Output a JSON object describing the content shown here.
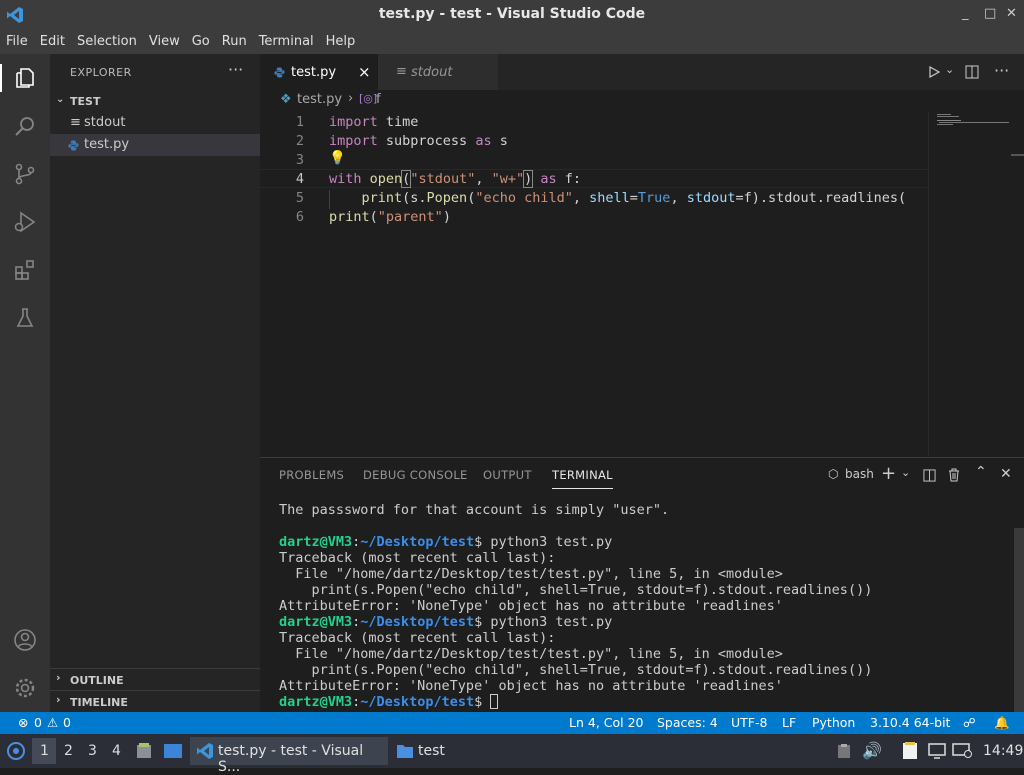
{
  "window": {
    "title": "test.py - test - Visual Studio Code",
    "minimize": "_",
    "maximize": "□",
    "close": "✕"
  },
  "menu": [
    "File",
    "Edit",
    "Selection",
    "View",
    "Go",
    "Run",
    "Terminal",
    "Help"
  ],
  "activity_icons": [
    "explorer-icon",
    "search-icon",
    "source-control-icon",
    "run-debug-icon",
    "extensions-icon",
    "testing-icon",
    "account-icon",
    "settings-gear-icon"
  ],
  "sidebar": {
    "title": "EXPLORER",
    "more": "···",
    "folder": "TEST",
    "files": [
      {
        "name": "stdout",
        "icon": "≡"
      },
      {
        "name": "test.py",
        "icon": "python-icon"
      }
    ],
    "outline": "OUTLINE",
    "timeline": "TIMELINE"
  },
  "tabs": [
    {
      "label": "test.py",
      "close": "×"
    },
    {
      "label": "stdout"
    }
  ],
  "breadcrumb": {
    "file": "test.py",
    "sep": "›",
    "symbol": "f"
  },
  "editor": {
    "line_numbers": [
      "1",
      "2",
      "3",
      "4",
      "5",
      "6"
    ],
    "current_line": 4
  },
  "panel": {
    "tabs": [
      "PROBLEMS",
      "DEBUG CONSOLE",
      "OUTPUT",
      "TERMINAL"
    ],
    "active_tab": "TERMINAL",
    "shell": "bash",
    "terminal": {
      "line1": "The passsword for that account is simply \"user\".",
      "user": "dartz@VM3",
      "path": "~/Desktop/test",
      "cmd": "$ python3 test.py",
      "tb1": "Traceback (most recent call last):",
      "tb2": "  File \"/home/dartz/Desktop/test/test.py\", line 5, in <module>",
      "tb3": "    print(s.Popen(\"echo child\", shell=True, stdout=f).stdout.readlines())",
      "tb4": "AttributeError: 'NoneType' object has no attribute 'readlines'",
      "prompt_end": "$ "
    }
  },
  "statusbar": {
    "errors": "0",
    "warnings": "0",
    "position": "Ln 4, Col 20",
    "spaces": "Spaces: 4",
    "encoding": "UTF-8",
    "eol": "LF",
    "language": "Python",
    "interpreter": "3.10.4 64-bit"
  },
  "taskbar": {
    "workspaces": [
      "1",
      "2",
      "3",
      "4"
    ],
    "apps": [
      {
        "label": "test.py - test - Visual S..."
      },
      {
        "label": "test"
      }
    ],
    "time": "14:49"
  },
  "colors": {
    "accent": "#007acc",
    "titlebar": "#3c3c3c",
    "activity": "#333333",
    "sidebar": "#252526",
    "editor": "#1e1e1e"
  }
}
